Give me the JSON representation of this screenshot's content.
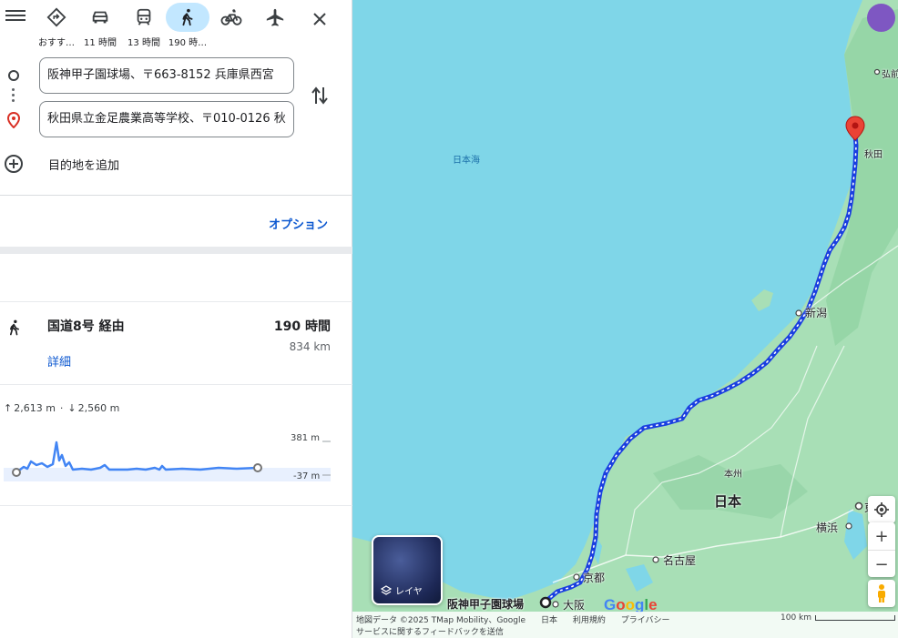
{
  "panel": {
    "modes": [
      {
        "name": "mode-recommended",
        "label": "おすす…"
      },
      {
        "name": "mode-driving",
        "label": "11 時間"
      },
      {
        "name": "mode-transit",
        "label": "13 時間"
      },
      {
        "name": "mode-walking",
        "label": "190 時…",
        "selected": true
      },
      {
        "name": "mode-cycling",
        "label": ""
      },
      {
        "name": "mode-flights",
        "label": ""
      }
    ],
    "origin_value": "阪神甲子園球場、〒663-8152 兵庫県西宮",
    "destination_value": "秋田県立金足農業高等学校、〒010-0126 秋",
    "add_destination": "目的地を追加",
    "options": "オプション",
    "route": {
      "via": "国道8号 経由",
      "duration": "190 時間",
      "distance": "834 km",
      "details": "詳細"
    },
    "elevation": {
      "ascent": "2,613 m",
      "separator": "·",
      "descent": "2,560 m",
      "max_label": "381 m",
      "min_label": "-37 m"
    }
  },
  "map": {
    "labels": {
      "sea": "日本海",
      "honshu": "本州",
      "japan": "日本",
      "akita": "秋田",
      "hirosaki": "弘前",
      "niigata": "新潟",
      "kyoto": "京都",
      "nagoya": "名古屋",
      "osaka": "大阪",
      "yokohama": "横浜",
      "tokyo_partial": "東",
      "origin": "阪神甲子園球場"
    },
    "layers_label": "レイヤ",
    "google": "Google",
    "attribution": {
      "data": "地図データ ©2025 TMap Mobility、Google",
      "country": "日本",
      "terms": "利用規約",
      "privacy": "プライバシー",
      "feedback": "サービスに関するフィードバックを送信",
      "scale": "100 km"
    },
    "colors": {
      "water": "#7fd6e8",
      "land": "#a8dfb6",
      "route": "#1a3fe0",
      "pin": "#ea4335"
    }
  }
}
